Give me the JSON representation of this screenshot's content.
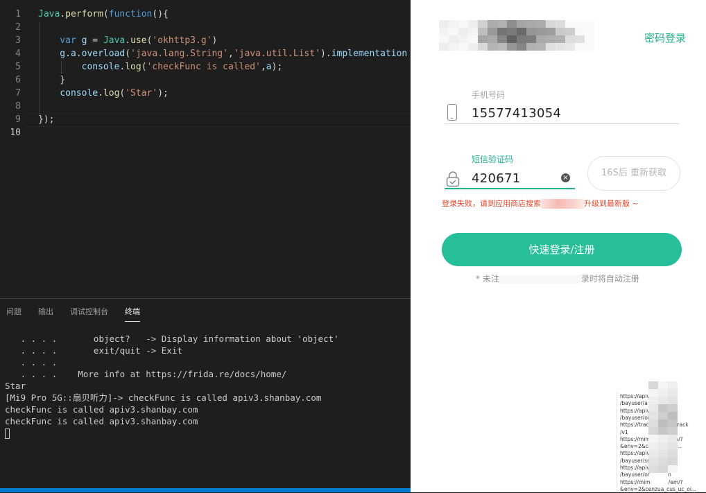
{
  "editor": {
    "lines": [
      {
        "n": "1",
        "tokens": [
          [
            "t-obj",
            "Java"
          ],
          [
            "t-p",
            "."
          ],
          [
            "t-fn",
            "perform"
          ],
          [
            "t-p",
            "("
          ],
          [
            "t-kw",
            "function"
          ],
          [
            "t-p",
            "(){"
          ]
        ]
      },
      {
        "n": "2",
        "tokens": []
      },
      {
        "n": "3",
        "tokens": [
          [
            "t-kw",
            "    var "
          ],
          [
            "t-var",
            "g"
          ],
          [
            "t-p",
            " = "
          ],
          [
            "t-obj",
            "Java"
          ],
          [
            "t-p",
            "."
          ],
          [
            "t-fn",
            "use"
          ],
          [
            "t-p",
            "("
          ],
          [
            "t-str",
            "'okhttp3.g'"
          ],
          [
            "t-p",
            ")"
          ]
        ]
      },
      {
        "n": "4",
        "tokens": [
          [
            "t-var",
            "    g"
          ],
          [
            "t-p",
            "."
          ],
          [
            "t-var",
            "a"
          ],
          [
            "t-p",
            "."
          ],
          [
            "t-var",
            "overload"
          ],
          [
            "t-p",
            "("
          ],
          [
            "t-str",
            "'java.lang.String'"
          ],
          [
            "t-p",
            ","
          ],
          [
            "t-str",
            "'java.util.List'"
          ],
          [
            "t-p",
            ")."
          ],
          [
            "t-var",
            "implementation"
          ],
          [
            "t-p",
            " ="
          ]
        ]
      },
      {
        "n": "5",
        "tokens": [
          [
            "t-var",
            "        console"
          ],
          [
            "t-p",
            "."
          ],
          [
            "t-fn",
            "log"
          ],
          [
            "t-p",
            "("
          ],
          [
            "t-str",
            "'checkFunc is called'"
          ],
          [
            "t-p",
            ","
          ],
          [
            "t-var",
            "a"
          ],
          [
            "t-p",
            ");"
          ]
        ]
      },
      {
        "n": "6",
        "tokens": [
          [
            "t-p",
            "    }"
          ]
        ]
      },
      {
        "n": "7",
        "tokens": [
          [
            "t-var",
            "    console"
          ],
          [
            "t-p",
            "."
          ],
          [
            "t-fn",
            "log"
          ],
          [
            "t-p",
            "("
          ],
          [
            "t-str",
            "'Star'"
          ],
          [
            "t-p",
            ");"
          ]
        ]
      },
      {
        "n": "8",
        "tokens": []
      },
      {
        "n": "9",
        "tokens": [
          [
            "t-p",
            "});"
          ]
        ]
      },
      {
        "n": "10",
        "tokens": []
      }
    ]
  },
  "panel": {
    "tabs": [
      {
        "label": "问题",
        "active": false
      },
      {
        "label": "输出",
        "active": false
      },
      {
        "label": "调试控制台",
        "active": false
      },
      {
        "label": "终端",
        "active": true
      }
    ],
    "terminal_lines": [
      "   . . . .       object?   -> Display information about 'object'",
      "   . . . .       exit/quit -> Exit",
      "   . . . .",
      "   . . . .    More info at https://frida.re/docs/home/",
      "Star",
      "[Mi9 Pro 5G::扇贝听力]-> checkFunc is called apiv3.shanbay.com",
      "checkFunc is called apiv3.shanbay.com",
      "checkFunc is called apiv3.shanbay.com"
    ]
  },
  "login": {
    "password_login": "密码登录",
    "phone_label": "手机号码",
    "phone_value": "15577413054",
    "sms_label": "短信验证码",
    "sms_value": "420671",
    "resend_label": "16S后 重新获取",
    "error_prefix": "登录失败，请到应用商店搜索",
    "error_suffix": "升级到最新版 ~",
    "login_button": "快速登录/注册",
    "notice_prefix": "* 未注",
    "notice_suffix": "录时将自动注册"
  },
  "netlog": {
    "lines": [
      "https://apiv           m",
      "/bayuser/a",
      "https://apiv           m",
      "/bayuser/or           n",
      "https://track           n/track",
      "/v1",
      "https://mim           /em/?",
      "&env=2&c           c_oi...",
      "https://apiv           m",
      "/bayuser/sr",
      "https://apiv           m",
      "/bayuser/or           n",
      "https://mim           /em/?",
      "&env=2&cenzua_cus_uc_oi..."
    ]
  },
  "colors": {
    "accent": "#26bf9a",
    "error": "#e8472b",
    "status_bar": "#007acc"
  }
}
